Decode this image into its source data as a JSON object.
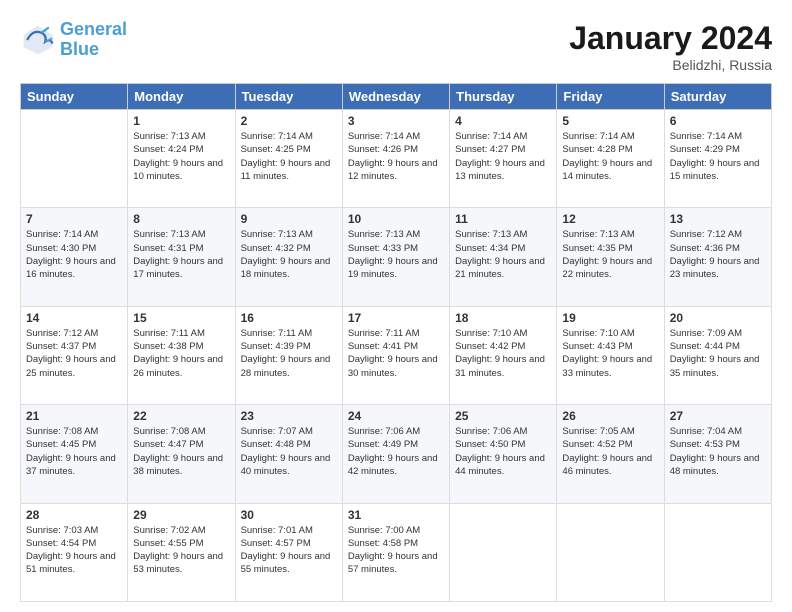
{
  "header": {
    "logo_line1": "General",
    "logo_line2": "Blue",
    "title": "January 2024",
    "subtitle": "Belidzhi, Russia"
  },
  "days_of_week": [
    "Sunday",
    "Monday",
    "Tuesday",
    "Wednesday",
    "Thursday",
    "Friday",
    "Saturday"
  ],
  "weeks": [
    [
      {
        "day": "",
        "sunrise": "",
        "sunset": "",
        "daylight": ""
      },
      {
        "day": "1",
        "sunrise": "Sunrise: 7:13 AM",
        "sunset": "Sunset: 4:24 PM",
        "daylight": "Daylight: 9 hours and 10 minutes."
      },
      {
        "day": "2",
        "sunrise": "Sunrise: 7:14 AM",
        "sunset": "Sunset: 4:25 PM",
        "daylight": "Daylight: 9 hours and 11 minutes."
      },
      {
        "day": "3",
        "sunrise": "Sunrise: 7:14 AM",
        "sunset": "Sunset: 4:26 PM",
        "daylight": "Daylight: 9 hours and 12 minutes."
      },
      {
        "day": "4",
        "sunrise": "Sunrise: 7:14 AM",
        "sunset": "Sunset: 4:27 PM",
        "daylight": "Daylight: 9 hours and 13 minutes."
      },
      {
        "day": "5",
        "sunrise": "Sunrise: 7:14 AM",
        "sunset": "Sunset: 4:28 PM",
        "daylight": "Daylight: 9 hours and 14 minutes."
      },
      {
        "day": "6",
        "sunrise": "Sunrise: 7:14 AM",
        "sunset": "Sunset: 4:29 PM",
        "daylight": "Daylight: 9 hours and 15 minutes."
      }
    ],
    [
      {
        "day": "7",
        "sunrise": "Sunrise: 7:14 AM",
        "sunset": "Sunset: 4:30 PM",
        "daylight": "Daylight: 9 hours and 16 minutes."
      },
      {
        "day": "8",
        "sunrise": "Sunrise: 7:13 AM",
        "sunset": "Sunset: 4:31 PM",
        "daylight": "Daylight: 9 hours and 17 minutes."
      },
      {
        "day": "9",
        "sunrise": "Sunrise: 7:13 AM",
        "sunset": "Sunset: 4:32 PM",
        "daylight": "Daylight: 9 hours and 18 minutes."
      },
      {
        "day": "10",
        "sunrise": "Sunrise: 7:13 AM",
        "sunset": "Sunset: 4:33 PM",
        "daylight": "Daylight: 9 hours and 19 minutes."
      },
      {
        "day": "11",
        "sunrise": "Sunrise: 7:13 AM",
        "sunset": "Sunset: 4:34 PM",
        "daylight": "Daylight: 9 hours and 21 minutes."
      },
      {
        "day": "12",
        "sunrise": "Sunrise: 7:13 AM",
        "sunset": "Sunset: 4:35 PM",
        "daylight": "Daylight: 9 hours and 22 minutes."
      },
      {
        "day": "13",
        "sunrise": "Sunrise: 7:12 AM",
        "sunset": "Sunset: 4:36 PM",
        "daylight": "Daylight: 9 hours and 23 minutes."
      }
    ],
    [
      {
        "day": "14",
        "sunrise": "Sunrise: 7:12 AM",
        "sunset": "Sunset: 4:37 PM",
        "daylight": "Daylight: 9 hours and 25 minutes."
      },
      {
        "day": "15",
        "sunrise": "Sunrise: 7:11 AM",
        "sunset": "Sunset: 4:38 PM",
        "daylight": "Daylight: 9 hours and 26 minutes."
      },
      {
        "day": "16",
        "sunrise": "Sunrise: 7:11 AM",
        "sunset": "Sunset: 4:39 PM",
        "daylight": "Daylight: 9 hours and 28 minutes."
      },
      {
        "day": "17",
        "sunrise": "Sunrise: 7:11 AM",
        "sunset": "Sunset: 4:41 PM",
        "daylight": "Daylight: 9 hours and 30 minutes."
      },
      {
        "day": "18",
        "sunrise": "Sunrise: 7:10 AM",
        "sunset": "Sunset: 4:42 PM",
        "daylight": "Daylight: 9 hours and 31 minutes."
      },
      {
        "day": "19",
        "sunrise": "Sunrise: 7:10 AM",
        "sunset": "Sunset: 4:43 PM",
        "daylight": "Daylight: 9 hours and 33 minutes."
      },
      {
        "day": "20",
        "sunrise": "Sunrise: 7:09 AM",
        "sunset": "Sunset: 4:44 PM",
        "daylight": "Daylight: 9 hours and 35 minutes."
      }
    ],
    [
      {
        "day": "21",
        "sunrise": "Sunrise: 7:08 AM",
        "sunset": "Sunset: 4:45 PM",
        "daylight": "Daylight: 9 hours and 37 minutes."
      },
      {
        "day": "22",
        "sunrise": "Sunrise: 7:08 AM",
        "sunset": "Sunset: 4:47 PM",
        "daylight": "Daylight: 9 hours and 38 minutes."
      },
      {
        "day": "23",
        "sunrise": "Sunrise: 7:07 AM",
        "sunset": "Sunset: 4:48 PM",
        "daylight": "Daylight: 9 hours and 40 minutes."
      },
      {
        "day": "24",
        "sunrise": "Sunrise: 7:06 AM",
        "sunset": "Sunset: 4:49 PM",
        "daylight": "Daylight: 9 hours and 42 minutes."
      },
      {
        "day": "25",
        "sunrise": "Sunrise: 7:06 AM",
        "sunset": "Sunset: 4:50 PM",
        "daylight": "Daylight: 9 hours and 44 minutes."
      },
      {
        "day": "26",
        "sunrise": "Sunrise: 7:05 AM",
        "sunset": "Sunset: 4:52 PM",
        "daylight": "Daylight: 9 hours and 46 minutes."
      },
      {
        "day": "27",
        "sunrise": "Sunrise: 7:04 AM",
        "sunset": "Sunset: 4:53 PM",
        "daylight": "Daylight: 9 hours and 48 minutes."
      }
    ],
    [
      {
        "day": "28",
        "sunrise": "Sunrise: 7:03 AM",
        "sunset": "Sunset: 4:54 PM",
        "daylight": "Daylight: 9 hours and 51 minutes."
      },
      {
        "day": "29",
        "sunrise": "Sunrise: 7:02 AM",
        "sunset": "Sunset: 4:55 PM",
        "daylight": "Daylight: 9 hours and 53 minutes."
      },
      {
        "day": "30",
        "sunrise": "Sunrise: 7:01 AM",
        "sunset": "Sunset: 4:57 PM",
        "daylight": "Daylight: 9 hours and 55 minutes."
      },
      {
        "day": "31",
        "sunrise": "Sunrise: 7:00 AM",
        "sunset": "Sunset: 4:58 PM",
        "daylight": "Daylight: 9 hours and 57 minutes."
      },
      {
        "day": "",
        "sunrise": "",
        "sunset": "",
        "daylight": ""
      },
      {
        "day": "",
        "sunrise": "",
        "sunset": "",
        "daylight": ""
      },
      {
        "day": "",
        "sunrise": "",
        "sunset": "",
        "daylight": ""
      }
    ]
  ]
}
